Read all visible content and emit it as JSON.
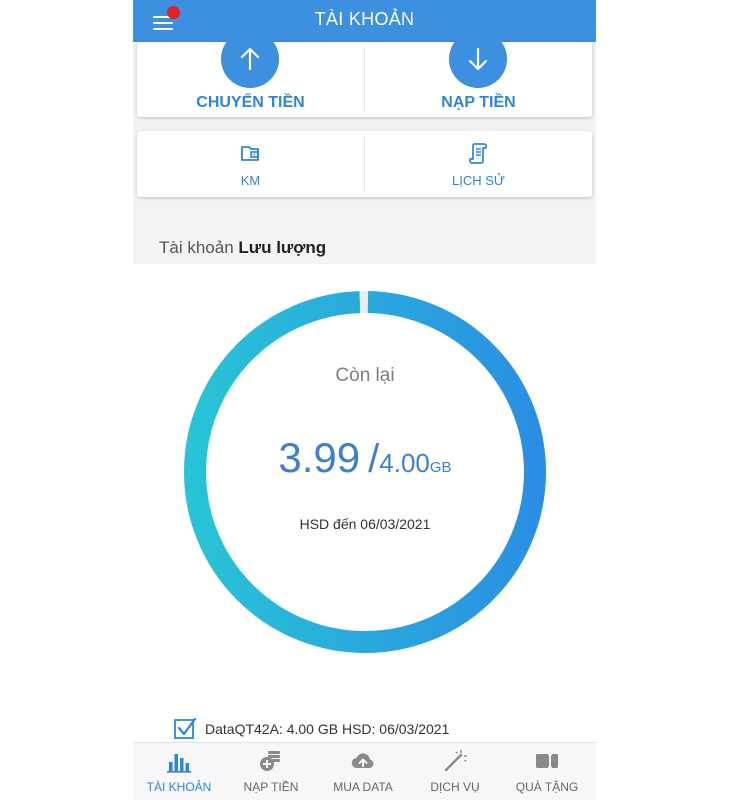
{
  "header": {
    "title": "TÀI KHOẢN"
  },
  "actions": {
    "transfer_label": "CHUYỂN TIỀN",
    "topup_label": "NẠP TIỀN",
    "promo_label": "KM",
    "history_label": "LỊCH SỬ"
  },
  "section": {
    "prefix": "Tài khoản",
    "name": "Lưu lượng"
  },
  "usage": {
    "remaining_label": "Còn lại",
    "remaining": "3.99",
    "separator": "/",
    "total": "4.00",
    "unit": "GB",
    "expiry": "HSD đến 06/03/2021",
    "remaining_fraction": 0.9975
  },
  "package": {
    "text": "DataQT42A: 4.00 GB HSD: 06/03/2021",
    "checked": true
  },
  "bottom_nav": [
    {
      "label": "TÀI KHOẢN",
      "icon": "bar-chart-icon",
      "active": true
    },
    {
      "label": "NẠP TIỀN",
      "icon": "topup-coins-icon",
      "active": false
    },
    {
      "label": "MUA DATA",
      "icon": "cloud-upload-icon",
      "active": false
    },
    {
      "label": "DỊCH VỤ",
      "icon": "magic-wand-icon",
      "active": false
    },
    {
      "label": "QUÀ TẶNG",
      "icon": "gift-ticket-icon",
      "active": false
    }
  ],
  "colors": {
    "primary": "#3d8fe0",
    "accent_text": "#2f86d6",
    "ring_start": "#28c3d6",
    "ring_end": "#2a8fe3",
    "notification": "#e3211f"
  }
}
